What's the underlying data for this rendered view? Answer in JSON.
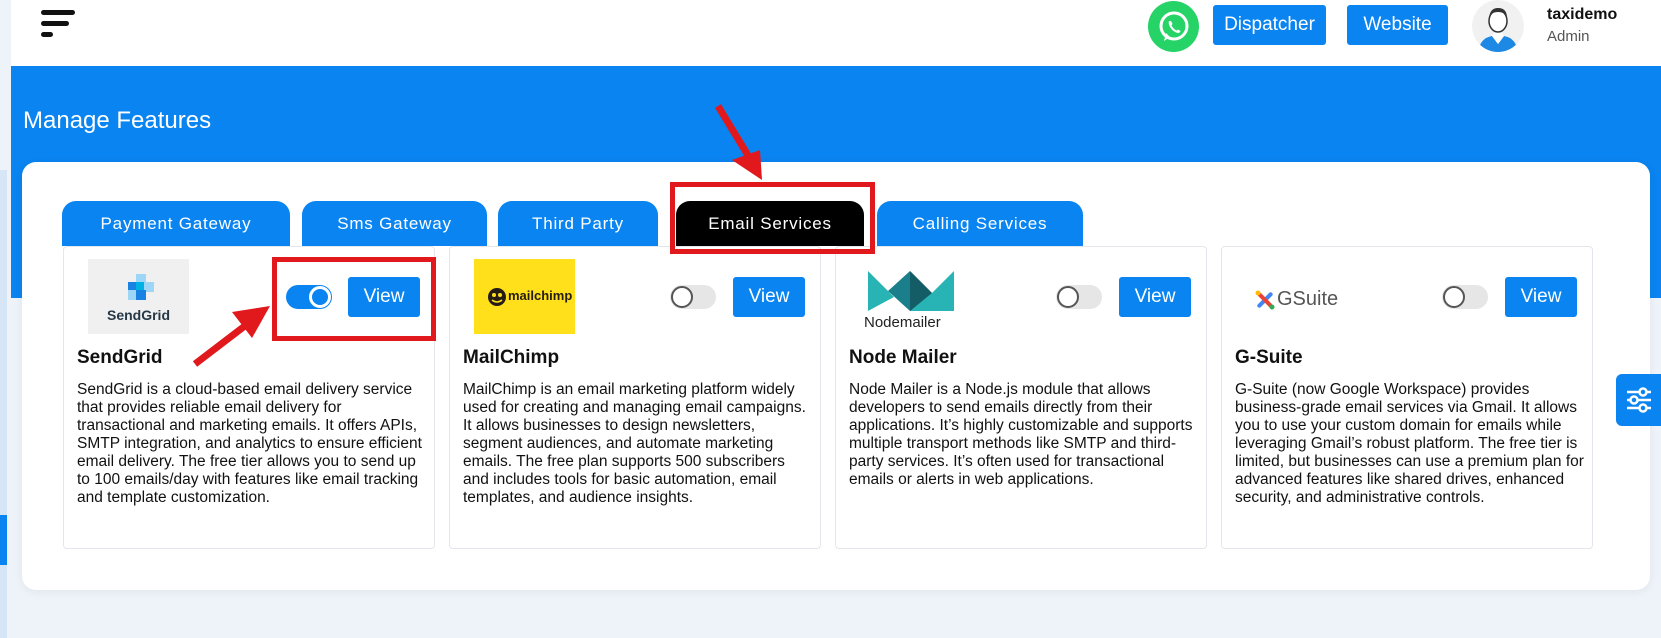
{
  "header": {
    "dispatcher_label": "Dispatcher",
    "website_label": "Website",
    "user_name": "taxidemo",
    "user_role": "Admin"
  },
  "page_title": "Manage Features",
  "tabs": [
    {
      "label": "Payment Gateway",
      "active": false
    },
    {
      "label": "Sms Gateway",
      "active": false
    },
    {
      "label": "Third Party",
      "active": false
    },
    {
      "label": "Email Services",
      "active": true
    },
    {
      "label": "Calling Services",
      "active": false
    }
  ],
  "features": [
    {
      "name": "SendGrid",
      "enabled": true,
      "view_label": "View",
      "logo_text": "SendGrid",
      "description": "SendGrid is a cloud-based email delivery service that provides reliable email delivery for transactional and marketing emails. It offers APIs, SMTP integration, and analytics to ensure efficient email delivery. The free tier allows you to send up to 100 emails/day with features like email tracking and template customization."
    },
    {
      "name": "MailChimp",
      "enabled": false,
      "view_label": "View",
      "logo_text": "mailchimp",
      "description": "MailChimp is an email marketing platform widely used for creating and managing email campaigns. It allows businesses to design newsletters, segment audiences, and automate marketing emails. The free plan supports 500 subscribers and includes tools for basic automation, email templates, and audience insights."
    },
    {
      "name": "Node Mailer",
      "enabled": false,
      "view_label": "View",
      "logo_text": "Nodemailer",
      "description": "Node Mailer is a Node.js module that allows developers to send emails directly from their applications. It’s highly customizable and supports multiple transport methods like SMTP and third-party services. It’s often used for transactional emails or alerts in web applications."
    },
    {
      "name": "G-Suite",
      "enabled": false,
      "view_label": "View",
      "logo_text": "GSuite",
      "description": "G-Suite (now Google Workspace) provides business-grade email services via Gmail. It allows you to use your custom domain for emails while leveraging Gmail’s robust platform. The free tier is limited, but businesses can use a premium plan for advanced features like shared drives, enhanced security, and administrative controls."
    }
  ],
  "colors": {
    "primary": "#0a84f0",
    "active_tab": "#000000",
    "annotation": "#e1191d",
    "whatsapp": "#25d366"
  }
}
